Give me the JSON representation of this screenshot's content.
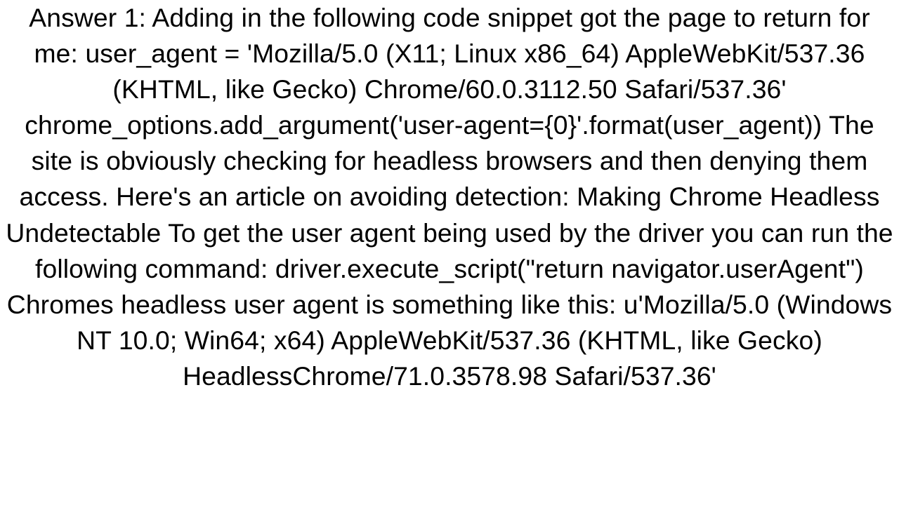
{
  "answer": {
    "text": "Answer 1: Adding in the following code snippet got the page to return for me: user_agent = 'Mozilla/5.0 (X11; Linux x86_64) AppleWebKit/537.36 (KHTML, like Gecko) Chrome/60.0.3112.50 Safari/537.36' chrome_options.add_argument('user-agent={0}'.format(user_agent))  The site is obviously checking for headless browsers and then denying them access. Here's an article on avoiding detection: Making Chrome Headless Undetectable To get the user agent being used by the driver you can run the following command: driver.execute_script(\"return navigator.userAgent\")  Chromes headless user agent is something like this:  u'Mozilla/5.0 (Windows NT 10.0; Win64; x64) AppleWebKit/537.36 (KHTML, like Gecko) HeadlessChrome/71.0.3578.98 Safari/537.36'"
  }
}
